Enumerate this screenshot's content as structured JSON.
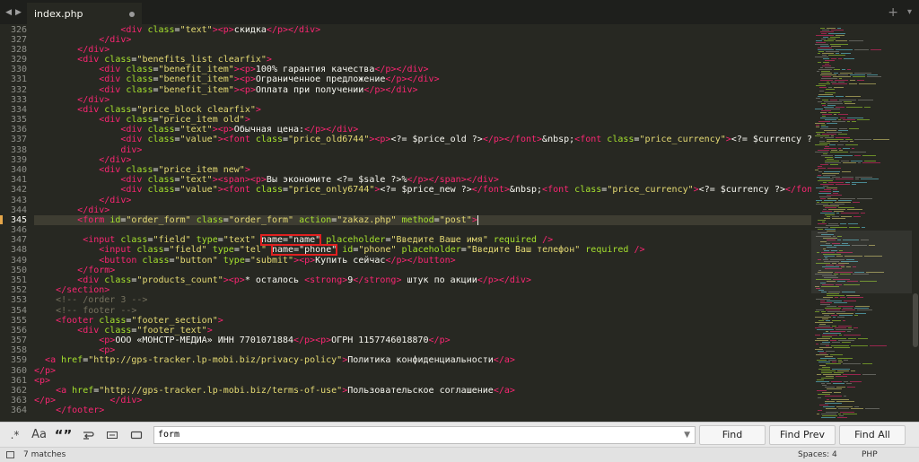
{
  "tabs": [
    {
      "label": "index.php",
      "modified": true
    }
  ],
  "editor": {
    "first_line": 326,
    "active_line": 345,
    "lines": [
      [
        [
          "tx",
          "                "
        ],
        [
          "tg",
          "<div "
        ],
        [
          "at",
          "class"
        ],
        [
          "tx",
          "="
        ],
        [
          "st",
          "\"text\""
        ],
        [
          "tg",
          "><p>"
        ],
        [
          "tx",
          "скидка"
        ],
        [
          "tg",
          "</p></div>"
        ]
      ],
      [
        [
          "tx",
          "            "
        ],
        [
          "tg",
          "</div>"
        ]
      ],
      [
        [
          "tx",
          "        "
        ],
        [
          "tg",
          "</div>"
        ]
      ],
      [
        [
          "tx",
          "        "
        ],
        [
          "tg",
          "<div "
        ],
        [
          "at",
          "class"
        ],
        [
          "tx",
          "="
        ],
        [
          "st",
          "\"benefits_list clearfix\""
        ],
        [
          "tg",
          ">"
        ]
      ],
      [
        [
          "tx",
          "            "
        ],
        [
          "tg",
          "<div "
        ],
        [
          "at",
          "class"
        ],
        [
          "tx",
          "="
        ],
        [
          "st",
          "\"benefit_item\""
        ],
        [
          "tg",
          "><p>"
        ],
        [
          "tx",
          "100% гарантия качества"
        ],
        [
          "tg",
          "</p></div>"
        ]
      ],
      [
        [
          "tx",
          "            "
        ],
        [
          "tg",
          "<div "
        ],
        [
          "at",
          "class"
        ],
        [
          "tx",
          "="
        ],
        [
          "st",
          "\"benefit_item\""
        ],
        [
          "tg",
          "><p>"
        ],
        [
          "tx",
          "Ограниченное предложение"
        ],
        [
          "tg",
          "</p></div>"
        ]
      ],
      [
        [
          "tx",
          "            "
        ],
        [
          "tg",
          "<div "
        ],
        [
          "at",
          "class"
        ],
        [
          "tx",
          "="
        ],
        [
          "st",
          "\"benefit_item\""
        ],
        [
          "tg",
          "><p>"
        ],
        [
          "tx",
          "Оплата при получении"
        ],
        [
          "tg",
          "</p></div>"
        ]
      ],
      [
        [
          "tx",
          "        "
        ],
        [
          "tg",
          "</div>"
        ]
      ],
      [
        [
          "tx",
          "        "
        ],
        [
          "tg",
          "<div "
        ],
        [
          "at",
          "class"
        ],
        [
          "tx",
          "="
        ],
        [
          "st",
          "\"price_block clearfix\""
        ],
        [
          "tg",
          ">"
        ]
      ],
      [
        [
          "tx",
          "            "
        ],
        [
          "tg",
          "<div "
        ],
        [
          "at",
          "class"
        ],
        [
          "tx",
          "="
        ],
        [
          "st",
          "\"price_item old\""
        ],
        [
          "tg",
          ">"
        ]
      ],
      [
        [
          "tx",
          "                "
        ],
        [
          "tg",
          "<div "
        ],
        [
          "at",
          "class"
        ],
        [
          "tx",
          "="
        ],
        [
          "st",
          "\"text\""
        ],
        [
          "tg",
          "><p>"
        ],
        [
          "tx",
          "Обычная цена:"
        ],
        [
          "tg",
          "</p></div>"
        ]
      ],
      [
        [
          "tx",
          "                "
        ],
        [
          "tg",
          "<div "
        ],
        [
          "at",
          "class"
        ],
        [
          "tx",
          "="
        ],
        [
          "st",
          "\"value\""
        ],
        [
          "tg",
          "><font "
        ],
        [
          "at",
          "class"
        ],
        [
          "tx",
          "="
        ],
        [
          "st",
          "\"price_old6744\""
        ],
        [
          "tg",
          "><p>"
        ],
        [
          "tx",
          "<?= "
        ],
        [
          "vr",
          "$price_old"
        ],
        [
          "tx",
          " ?>"
        ],
        [
          "tg",
          "</p></font>"
        ],
        [
          "tx",
          "&nbsp;"
        ],
        [
          "tg",
          "<font "
        ],
        [
          "at",
          "class"
        ],
        [
          "tx",
          "="
        ],
        [
          "st",
          "\"price_currency\""
        ],
        [
          "tg",
          ">"
        ],
        [
          "tx",
          "<?= "
        ],
        [
          "vr",
          "$currency"
        ],
        [
          "tx",
          " ?>"
        ],
        [
          "tg",
          "</font></"
        ]
      ],
      [
        [
          "tx",
          "                "
        ],
        [
          "tg",
          "div>"
        ]
      ],
      [
        [
          "tx",
          "            "
        ],
        [
          "tg",
          "</div>"
        ]
      ],
      [
        [
          "tx",
          "            "
        ],
        [
          "tg",
          "<div "
        ],
        [
          "at",
          "class"
        ],
        [
          "tx",
          "="
        ],
        [
          "st",
          "\"price_item new\""
        ],
        [
          "tg",
          ">"
        ]
      ],
      [
        [
          "tx",
          "                "
        ],
        [
          "tg",
          "<div "
        ],
        [
          "at",
          "class"
        ],
        [
          "tx",
          "="
        ],
        [
          "st",
          "\"text\""
        ],
        [
          "tg",
          "><span><p>"
        ],
        [
          "tx",
          "Вы экономите <?= "
        ],
        [
          "vr",
          "$sale"
        ],
        [
          "tx",
          " ?>%"
        ],
        [
          "tg",
          "</p></span></div>"
        ]
      ],
      [
        [
          "tx",
          "                "
        ],
        [
          "tg",
          "<div "
        ],
        [
          "at",
          "class"
        ],
        [
          "tx",
          "="
        ],
        [
          "st",
          "\"value\""
        ],
        [
          "tg",
          "><font "
        ],
        [
          "at",
          "class"
        ],
        [
          "tx",
          "="
        ],
        [
          "st",
          "\"price_only6744\""
        ],
        [
          "tg",
          ">"
        ],
        [
          "tx",
          "<?= "
        ],
        [
          "vr",
          "$price_new"
        ],
        [
          "tx",
          " ?>"
        ],
        [
          "tg",
          "</font>"
        ],
        [
          "tx",
          "&nbsp;"
        ],
        [
          "tg",
          "<font "
        ],
        [
          "at",
          "class"
        ],
        [
          "tx",
          "="
        ],
        [
          "st",
          "\"price_currency\""
        ],
        [
          "tg",
          ">"
        ],
        [
          "tx",
          "<?= "
        ],
        [
          "vr",
          "$currency"
        ],
        [
          "tx",
          " ?>"
        ],
        [
          "tg",
          "</font></div>"
        ]
      ],
      [
        [
          "tx",
          "            "
        ],
        [
          "tg",
          "</div>"
        ]
      ],
      [
        [
          "tx",
          "        "
        ],
        [
          "tg",
          "</div>"
        ]
      ],
      [
        [
          "tx",
          "        "
        ],
        [
          "tg",
          "<"
        ],
        [
          "tg",
          "form"
        ],
        [
          "tx",
          " "
        ],
        [
          "at",
          "id"
        ],
        [
          "tx",
          "="
        ],
        [
          "st",
          "\"order_form\""
        ],
        [
          "tx",
          " "
        ],
        [
          "at",
          "class"
        ],
        [
          "tx",
          "="
        ],
        [
          "st",
          "\"order_form\""
        ],
        [
          "tx",
          " "
        ],
        [
          "at",
          "action"
        ],
        [
          "tx",
          "="
        ],
        [
          "st",
          "\"zakaz.php\""
        ],
        [
          "tx",
          " "
        ],
        [
          "at",
          "method"
        ],
        [
          "tx",
          "="
        ],
        [
          "st",
          "\"post\""
        ],
        [
          "tg",
          ">"
        ]
      ],
      [
        [
          "tx",
          "        "
        ]
      ],
      [
        [
          "tx",
          "         "
        ],
        [
          "tg",
          "<input "
        ],
        [
          "at",
          "class"
        ],
        [
          "tx",
          "="
        ],
        [
          "st",
          "\"field\""
        ],
        [
          "tx",
          " "
        ],
        [
          "at",
          "type"
        ],
        [
          "tx",
          "="
        ],
        [
          "st",
          "\"text\""
        ],
        [
          "tx",
          " "
        ],
        [
          "hl",
          "name=\"name\""
        ],
        [
          "tx",
          " "
        ],
        [
          "at",
          "placeholder"
        ],
        [
          "tx",
          "="
        ],
        [
          "st",
          "\"Введите Ваше имя\""
        ],
        [
          "tx",
          " "
        ],
        [
          "at",
          "required"
        ],
        [
          "tx",
          " "
        ],
        [
          "tg",
          "/>"
        ]
      ],
      [
        [
          "tx",
          "            "
        ],
        [
          "tg",
          "<input "
        ],
        [
          "at",
          "class"
        ],
        [
          "tx",
          "="
        ],
        [
          "st",
          "\"field\""
        ],
        [
          "tx",
          " "
        ],
        [
          "at",
          "type"
        ],
        [
          "tx",
          "="
        ],
        [
          "st",
          "\"tel\""
        ],
        [
          "tx",
          " "
        ],
        [
          "hl",
          "name=\"phone\""
        ],
        [
          "tx",
          " "
        ],
        [
          "at",
          "id"
        ],
        [
          "tx",
          "="
        ],
        [
          "st",
          "\"phone\""
        ],
        [
          "tx",
          " "
        ],
        [
          "at",
          "placeholder"
        ],
        [
          "tx",
          "="
        ],
        [
          "st",
          "\"Введите Ваш телефон\""
        ],
        [
          "tx",
          " "
        ],
        [
          "at",
          "required"
        ],
        [
          "tx",
          " "
        ],
        [
          "tg",
          "/>"
        ]
      ],
      [
        [
          "tx",
          "            "
        ],
        [
          "tg",
          "<button "
        ],
        [
          "at",
          "class"
        ],
        [
          "tx",
          "="
        ],
        [
          "st",
          "\"button\""
        ],
        [
          "tx",
          " "
        ],
        [
          "at",
          "type"
        ],
        [
          "tx",
          "="
        ],
        [
          "st",
          "\"submit\""
        ],
        [
          "tg",
          "><p>"
        ],
        [
          "tx",
          "Купить сейчас"
        ],
        [
          "tg",
          "</p></button>"
        ]
      ],
      [
        [
          "tx",
          "        "
        ],
        [
          "tg",
          "</form>"
        ]
      ],
      [
        [
          "tx",
          "        "
        ],
        [
          "tg",
          "<div "
        ],
        [
          "at",
          "class"
        ],
        [
          "tx",
          "="
        ],
        [
          "st",
          "\"products_count\""
        ],
        [
          "tg",
          "><p>"
        ],
        [
          "tx",
          "* осталось "
        ],
        [
          "tg",
          "<strong>"
        ],
        [
          "tx",
          "9"
        ],
        [
          "tg",
          "</strong>"
        ],
        [
          "tx",
          " штук по акции"
        ],
        [
          "tg",
          "</p></div>"
        ]
      ],
      [
        [
          "tx",
          "    "
        ],
        [
          "tg",
          "</section>"
        ]
      ],
      [
        [
          "tx",
          "    "
        ],
        [
          "cm",
          "<!-- /order 3 -->"
        ]
      ],
      [
        [
          "tx",
          "    "
        ],
        [
          "cm",
          "<!-- footer -->"
        ]
      ],
      [
        [
          "tx",
          "    "
        ],
        [
          "tg",
          "<footer "
        ],
        [
          "at",
          "class"
        ],
        [
          "tx",
          "="
        ],
        [
          "st",
          "\"footer_section\""
        ],
        [
          "tg",
          ">"
        ]
      ],
      [
        [
          "tx",
          "        "
        ],
        [
          "tg",
          "<div "
        ],
        [
          "at",
          "class"
        ],
        [
          "tx",
          "="
        ],
        [
          "st",
          "\"footer_text\""
        ],
        [
          "tg",
          ">"
        ]
      ],
      [
        [
          "tx",
          "            "
        ],
        [
          "tg",
          "<p>"
        ],
        [
          "tx",
          "ООО «МОНСТР-МЕДИА» ИНН 7701071884"
        ],
        [
          "tg",
          "</p><p>"
        ],
        [
          "tx",
          "ОГРН 1157746018870"
        ],
        [
          "tg",
          "</p>"
        ]
      ],
      [
        [
          "tx",
          "            "
        ],
        [
          "tg",
          "<p>"
        ]
      ],
      [
        [
          "tx",
          "  "
        ],
        [
          "tg",
          "<a "
        ],
        [
          "at",
          "href"
        ],
        [
          "tx",
          "="
        ],
        [
          "st",
          "\"http://gps-tracker.lp-mobi.biz/privacy-policy\""
        ],
        [
          "tg",
          ">"
        ],
        [
          "tx",
          "Политика конфиденциальности"
        ],
        [
          "tg",
          "</a>"
        ]
      ],
      [
        [
          "tg",
          "</p>"
        ]
      ],
      [
        [
          "tg",
          "<p>"
        ]
      ],
      [
        [
          "tx",
          "    "
        ],
        [
          "tg",
          "<a "
        ],
        [
          "at",
          "href"
        ],
        [
          "tx",
          "="
        ],
        [
          "st",
          "\"http://gps-tracker.lp-mobi.biz/terms-of-use\""
        ],
        [
          "tg",
          ">"
        ],
        [
          "tx",
          "Пользовательское соглашение"
        ],
        [
          "tg",
          "</a>"
        ]
      ],
      [
        [
          "tg",
          "</p>"
        ],
        [
          "tx",
          "          "
        ],
        [
          "tg",
          "</div>"
        ]
      ],
      [
        [
          "tx",
          "    "
        ],
        [
          "tg",
          "</footer>"
        ]
      ]
    ]
  },
  "find_panel": {
    "option_regex": ".*",
    "option_case": "Aa",
    "option_word": "“”",
    "query": "form",
    "find_label": "Find",
    "find_prev_label": "Find Prev",
    "find_all_label": "Find All"
  },
  "status_bar": {
    "matches": "7 matches",
    "indentation": "Spaces: 4",
    "syntax": "PHP"
  },
  "colors": {
    "background": "#272822",
    "tag": "#f92672",
    "attribute": "#a6e22e",
    "string": "#e6db74",
    "text": "#f8f8f2",
    "line_number": "#8f908a",
    "highlight_box": "#e02020"
  }
}
